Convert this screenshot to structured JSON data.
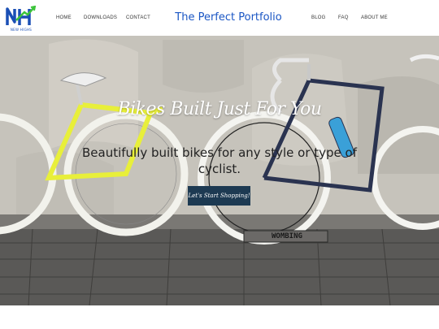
{
  "header": {
    "logo_text": "NH",
    "logo_tag": "NEW HIGHS",
    "nav_left": [
      "HOME",
      "DOWNLOADS",
      "CONTACT"
    ],
    "title": "The Perfect Portfolio",
    "nav_right": [
      "BLOG",
      "FAQ",
      "ABOUT ME"
    ]
  },
  "hero": {
    "title": "Bikes Built Just For You",
    "subtitle": "Beautifully built bikes for any style or type of cyclist.",
    "cta_label": "Let's Start Shopping!",
    "sign_text": "WOMBING"
  },
  "colors": {
    "accent": "#1a56c4",
    "cta_bg": "#1d3a52",
    "yellow_bike": "#e8ef3a",
    "dark_bike": "#2a3350"
  }
}
